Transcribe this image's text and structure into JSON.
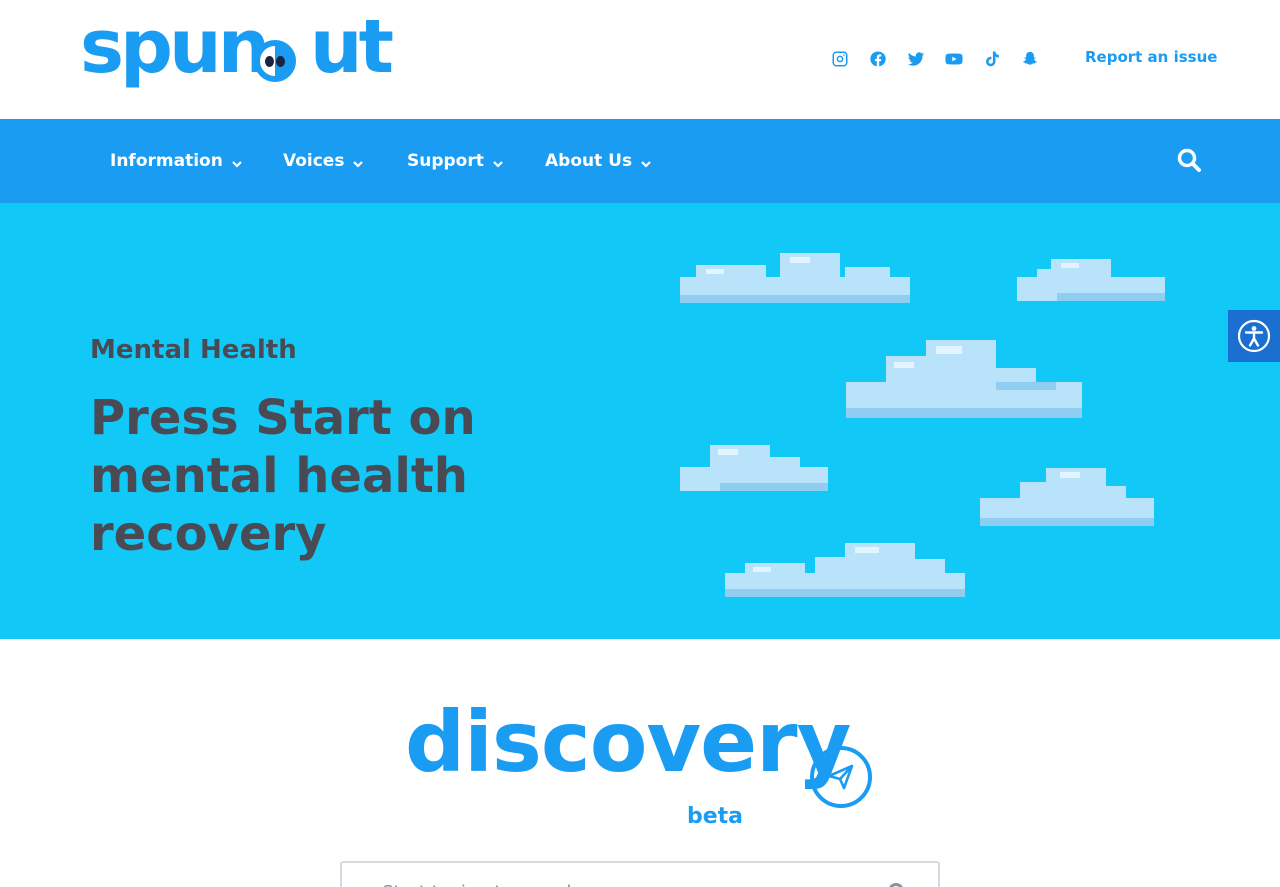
{
  "brand": {
    "logo_text": "spunout",
    "primary_color": "#1a9cf2",
    "hero_color": "#11c8f7",
    "heading_color": "#4a4a55"
  },
  "header": {
    "social_icons": [
      "instagram-icon",
      "facebook-icon",
      "twitter-icon",
      "youtube-icon",
      "tiktok-icon",
      "snapchat-icon"
    ],
    "report_link": "Report an issue"
  },
  "nav": {
    "items": [
      {
        "label": "Information"
      },
      {
        "label": "Voices"
      },
      {
        "label": "Support"
      },
      {
        "label": "About Us"
      }
    ],
    "search_icon": "search-icon"
  },
  "hero": {
    "kicker": "Mental Health",
    "title": "Press Start on mental health recovery"
  },
  "discovery": {
    "word": "discovery",
    "badge": "beta",
    "search_placeholder": "Start typing to search"
  },
  "accessibility": {
    "icon": "accessibility-icon"
  }
}
